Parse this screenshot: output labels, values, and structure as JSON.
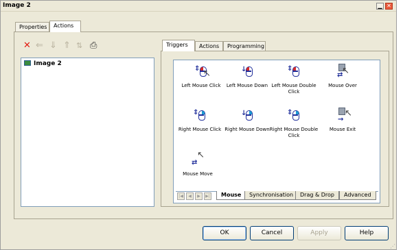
{
  "window": {
    "title": "Image 2",
    "min_label": "▁",
    "close_label": "✕"
  },
  "outer_tabs": [
    {
      "label": "Properties"
    },
    {
      "label": "Actions"
    }
  ],
  "toolbar": {
    "delete_icon": "✕",
    "left_icon": "⇐",
    "down_icon": "⇓",
    "up_icon": "⇑",
    "updown_icon": "⇅",
    "print_icon": "⎙"
  },
  "object_list": [
    {
      "label": "Image 2"
    }
  ],
  "inner_tabs": [
    {
      "label": "Triggers"
    },
    {
      "label": "Actions"
    },
    {
      "label": "Programming"
    }
  ],
  "triggers": [
    {
      "label": "Left Mouse Click",
      "icon": "mouse-left-click-icon"
    },
    {
      "label": "Left Mouse Down",
      "icon": "mouse-left-down-icon"
    },
    {
      "label": "Left Mouse Double Click",
      "icon": "mouse-left-double-click-icon"
    },
    {
      "label": "Mouse Over",
      "icon": "mouse-over-icon"
    },
    {
      "label": "Right Mouse Click",
      "icon": "mouse-right-click-icon"
    },
    {
      "label": "Right Mouse Down",
      "icon": "mouse-right-down-icon"
    },
    {
      "label": "Right Mouse Double Click",
      "icon": "mouse-right-double-click-icon"
    },
    {
      "label": "Mouse Exit",
      "icon": "mouse-exit-icon"
    },
    {
      "label": "Mouse Move",
      "icon": "mouse-move-icon"
    }
  ],
  "category_tabs": [
    {
      "label": "Mouse",
      "active": true
    },
    {
      "label": "Synchronisation",
      "active": false
    },
    {
      "label": "Drag & Drop",
      "active": false
    },
    {
      "label": "Advanced",
      "active": false
    }
  ],
  "nav": {
    "first": "|◀",
    "prev": "◀",
    "next": "▶",
    "last": "▶|"
  },
  "buttons": {
    "ok": "OK",
    "cancel": "Cancel",
    "apply": "Apply",
    "help": "Help"
  },
  "colors": {
    "window_bg": "#ece9d8",
    "delete_red": "#e21c12",
    "mouse_blue": "#1f2d9a",
    "click_red": "#d42a2a",
    "click_cyan": "#1e9bd3"
  }
}
